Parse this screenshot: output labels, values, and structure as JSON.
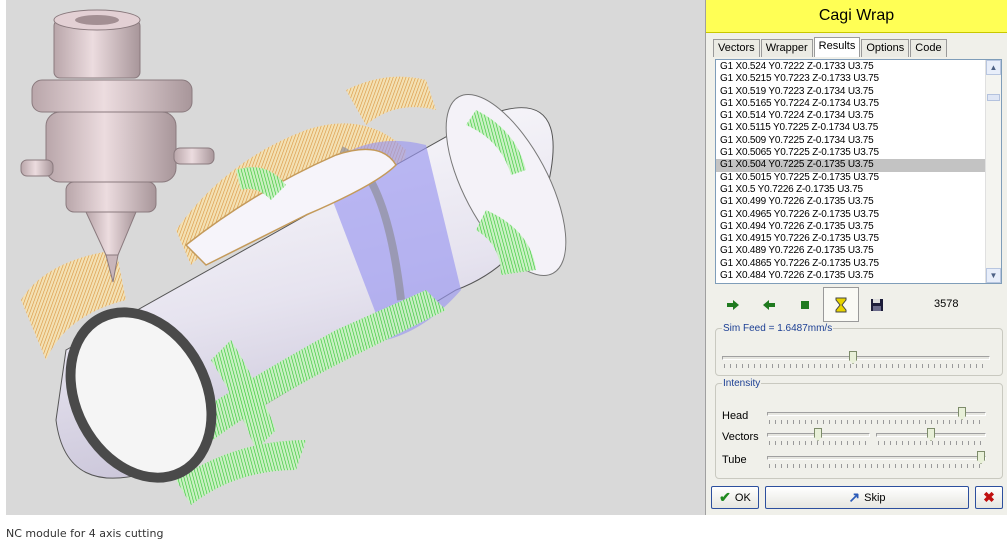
{
  "window": {
    "title": "Cagi Wrap"
  },
  "tabs": [
    {
      "label": "Vectors"
    },
    {
      "label": "Wrapper"
    },
    {
      "label": "Results",
      "active": true
    },
    {
      "label": "Options"
    },
    {
      "label": "Code"
    }
  ],
  "results": {
    "selected_index": 8,
    "lines": [
      "G1 X0.524 Y0.7222 Z-0.1733 U3.75",
      "G1 X0.5215 Y0.7223 Z-0.1733 U3.75",
      "G1 X0.519 Y0.7223 Z-0.1734 U3.75",
      "G1 X0.5165 Y0.7224 Z-0.1734 U3.75",
      "G1 X0.514 Y0.7224 Z-0.1734 U3.75",
      "G1 X0.5115 Y0.7225 Z-0.1734 U3.75",
      "G1 X0.509 Y0.7225 Z-0.1734 U3.75",
      "G1 X0.5065 Y0.7225 Z-0.1735 U3.75",
      "G1 X0.504 Y0.7225 Z-0.1735 U3.75",
      "G1 X0.5015 Y0.7225 Z-0.1735 U3.75",
      "G1 X0.5 Y0.7226 Z-0.1735 U3.75",
      "G1 X0.499 Y0.7226 Z-0.1735 U3.75",
      "G1 X0.4965 Y0.7226 Z-0.1735 U3.75",
      "G1 X0.494 Y0.7226 Z-0.1735 U3.75",
      "G1 X0.4915 Y0.7226 Z-0.1735 U3.75",
      "G1 X0.489 Y0.7226 Z-0.1735 U3.75",
      "G1 X0.4865 Y0.7226 Z-0.1735 U3.75",
      "G1 X0.484 Y0.7226 Z-0.1735 U3.75"
    ]
  },
  "toolbar": {
    "buttons": [
      {
        "icon": "arrow-right-icon"
      },
      {
        "icon": "arrow-left-icon"
      },
      {
        "icon": "stop-icon"
      },
      {
        "icon": "hourglass-icon",
        "pressed": true
      },
      {
        "icon": "floppy-disk-icon"
      }
    ],
    "counter": "3578"
  },
  "sim_feed": {
    "label": "Sim Feed = 1.6487mm/s",
    "level": 0.49
  },
  "intensity": {
    "legend": "Intensity",
    "head": {
      "label": "Head",
      "level": 0.91
    },
    "vectors": {
      "label": "Vectors",
      "level_a": 0.5,
      "level_b": 0.5
    },
    "tube": {
      "label": "Tube",
      "level": 1.0
    }
  },
  "footer": {
    "ok_label": "OK",
    "skip_label": "Skip"
  },
  "caption": "NC module for 4 axis cutting",
  "colors": {
    "title_bar": "#ffff55",
    "viewport_bg": "#d9d9d9",
    "tube": "#e9e6f2",
    "vector_green": "#3ed13e",
    "vector_orange": "#e8a040",
    "plane_blue": "#9a96f0",
    "head": "#d9c4c8"
  }
}
